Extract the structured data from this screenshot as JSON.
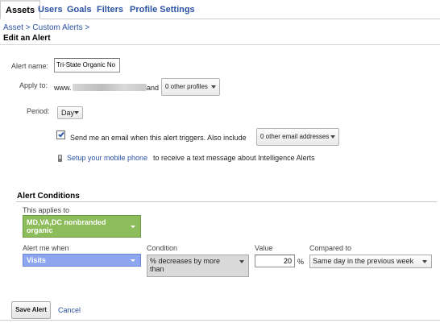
{
  "tabs": [
    {
      "label": "Assets",
      "active": true
    },
    {
      "label": "Users"
    },
    {
      "label": "Goals"
    },
    {
      "label": "Filters"
    },
    {
      "label": "Profile Settings"
    }
  ],
  "breadcrumb": "Asset > Custom Alerts >",
  "page_title": "Edit an Alert",
  "form": {
    "alert_name_label": "Alert name:",
    "alert_name_value": "Tri-State Organic No",
    "apply_to_label": "Apply to:",
    "apply_to_prefix": "www.",
    "apply_to_and": "and",
    "other_profiles": "0 other profiles",
    "period_label": "Period:",
    "period_value": "Day",
    "email_checked": true,
    "email_text": "Send me an email when this alert triggers. Also include",
    "other_emails": "0 other email addresses",
    "mobile_link": "Setup your mobile phone",
    "mobile_text": "to receive a text message about Intelligence Alerts"
  },
  "conditions": {
    "title": "Alert Conditions",
    "applies_to_label": "This applies to",
    "applies_to_value": "MD,VA,DC nonbranded organic",
    "alert_when_label": "Alert me when",
    "alert_when_value": "Visits",
    "condition_label": "Condition",
    "condition_value": "% decreases by more than",
    "value_label": "Value",
    "value": "20",
    "value_unit": "%",
    "compared_label": "Compared to",
    "compared_value": "Same day in the previous week"
  },
  "actions": {
    "save_label": "Save Alert",
    "cancel_label": "Cancel"
  },
  "colors": {
    "link": "#2b52a3",
    "segment_green": "#8dbc5a",
    "metric_blue": "#8ea6f0"
  }
}
